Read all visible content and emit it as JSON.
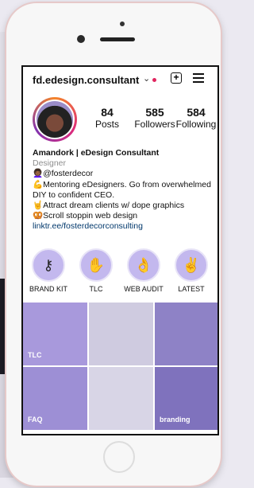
{
  "profile": {
    "username": "fd.edesign.consultant",
    "stats": [
      {
        "value": "84",
        "label": "Posts"
      },
      {
        "value": "585",
        "label": "Followers"
      },
      {
        "value": "584",
        "label": "Following"
      }
    ],
    "name": "Amandork | eDesign Consultant",
    "category": "Designer",
    "bio_lines": [
      "👩🏾‍🦱@fosterdecor",
      "💪Mentoring eDesigners. Go from overwhelmed DIY to confident CEO.",
      "🤘Attract dream clients w/ dope graphics",
      "🥨Scroll stoppin web design"
    ],
    "link": "linktr.ee/fosterdecorconsulting"
  },
  "highlights": [
    {
      "label": "BRAND KIT",
      "icon": "key-icon",
      "glyph": "⚷"
    },
    {
      "label": "TLC",
      "icon": "hand-icon",
      "glyph": "✋"
    },
    {
      "label": "WEB AUDIT",
      "icon": "ok-hand-icon",
      "glyph": "👌"
    },
    {
      "label": "LATEST",
      "icon": "peace-icon",
      "glyph": "✌"
    }
  ],
  "grid": [
    {
      "label": "TLC",
      "bg": "#a899dc"
    },
    {
      "label": "",
      "bg": "#cfcbe0"
    },
    {
      "label": "",
      "bg": "#8e82c6"
    },
    {
      "label": "FAQ",
      "bg": "#9d8fd5"
    },
    {
      "label": "",
      "bg": "#d8d5e6"
    },
    {
      "label": "branding",
      "bg": "#7f72bd"
    }
  ],
  "colors": {
    "accent": "#c3b8ee",
    "notification": "#e0245e",
    "link": "#00376b"
  }
}
